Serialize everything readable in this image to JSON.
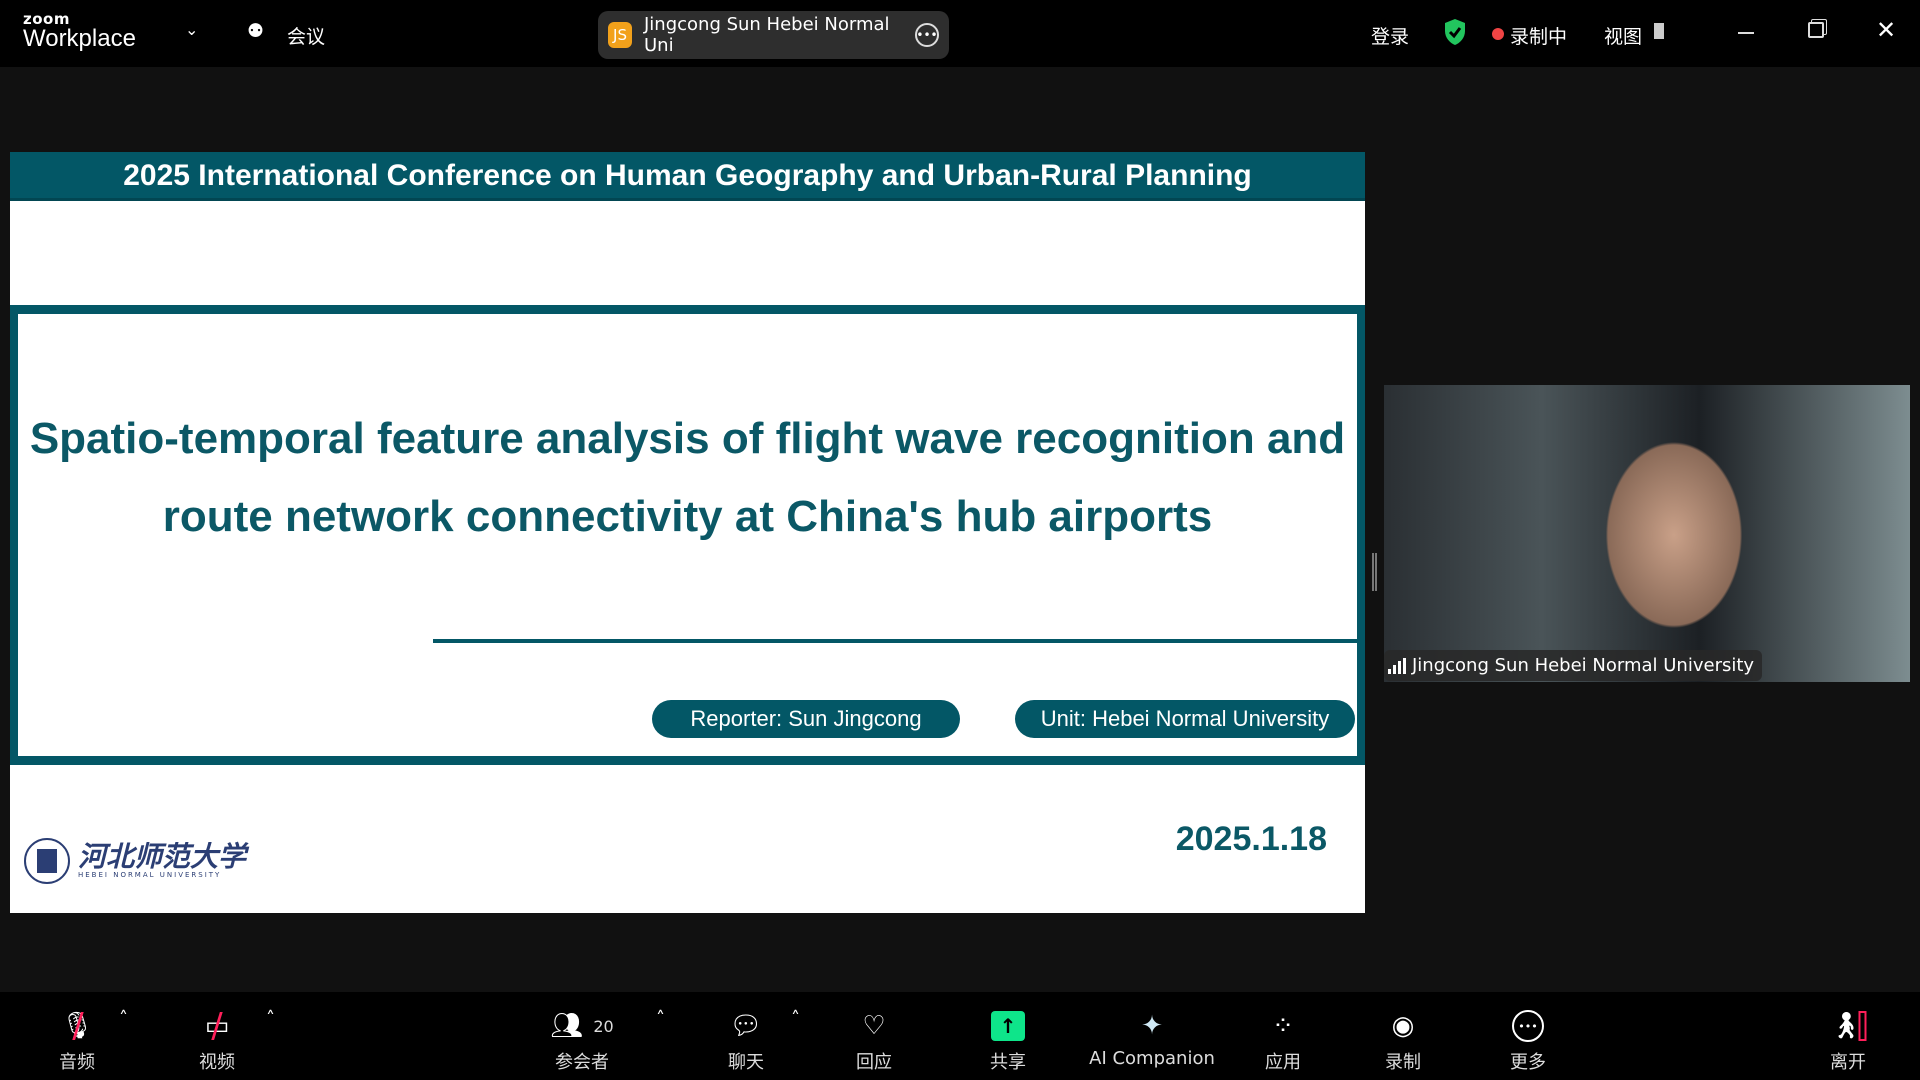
{
  "topbar": {
    "brand_small": "zoom",
    "brand": "Workplace",
    "meeting_label": "会议",
    "active_speaker_initials": "JS",
    "active_speaker": "Jingcong Sun  Hebei Normal Uni",
    "signin": "登录",
    "recording": "录制中",
    "view": "视图",
    "colors": {
      "secure": "#22c55e",
      "recording_dot": "#ef4444"
    }
  },
  "slide": {
    "conference": "2025 International Conference on Human Geography and Urban-Rural Planning",
    "title_line1": "Spatio-temporal feature analysis of flight wave recognition and",
    "title_line2": "route network connectivity at China's hub airports",
    "reporter": "Reporter: Sun Jingcong",
    "unit": "Unit: Hebei Normal University",
    "date": "2025.1.18",
    "logo_cn": "河北师范大学",
    "logo_en": "HEBEI NORMAL UNIVERSITY",
    "accent": "#035766"
  },
  "video": {
    "participant": "Jingcong Sun  Hebei Normal University"
  },
  "toolbar": {
    "audio": "音频",
    "video": "视频",
    "participants": "参会者",
    "participant_count": "20",
    "chat": "聊天",
    "reactions": "回应",
    "share": "共享",
    "ai": "AI Companion",
    "apps": "应用",
    "record": "录制",
    "more": "更多",
    "leave": "离开",
    "share_color": "#0ee58a",
    "leave_color": "#ff1f5a"
  }
}
